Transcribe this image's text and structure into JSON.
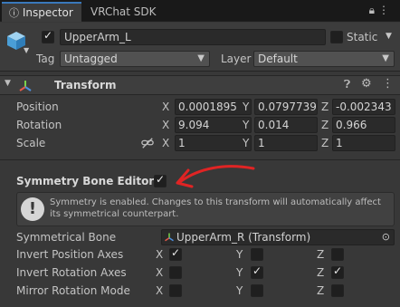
{
  "tabs": {
    "inspector": "Inspector",
    "vrchat_sdk": "VRChat SDK"
  },
  "object": {
    "name": "UpperArm_L",
    "static_label": "Static",
    "tag_label": "Tag",
    "tag_value": "Untagged",
    "layer_label": "Layer",
    "layer_value": "Default"
  },
  "transform": {
    "title": "Transform",
    "position": {
      "label": "Position",
      "x": "0.0001895",
      "y": "0.0797739",
      "z": "-0.002343"
    },
    "rotation": {
      "label": "Rotation",
      "x": "9.094",
      "y": "0.014",
      "z": "0.966"
    },
    "scale": {
      "label": "Scale",
      "x": "1",
      "y": "1",
      "z": "1"
    }
  },
  "axes": {
    "x": "X",
    "y": "Y",
    "z": "Z"
  },
  "symmetry": {
    "title": "Symmetry Bone Editor",
    "enabled": true,
    "info": "Symmetry is enabled. Changes to this transform will automatically affect its symmetrical counterpart.",
    "bone_label": "Symmetrical Bone",
    "bone_value": "UpperArm_R (Transform)",
    "invert_position_label": "Invert Position Axes",
    "invert_rotation_label": "Invert Rotation Axes",
    "mirror_rotation_label": "Mirror Rotation Mode",
    "invert_position": [
      true,
      false,
      false
    ],
    "invert_rotation": [
      false,
      true,
      true
    ],
    "mirror_rotation": [
      false,
      false,
      false
    ]
  },
  "colors": {
    "accent": "#3a79bb",
    "annotation_arrow": "#e02424"
  }
}
